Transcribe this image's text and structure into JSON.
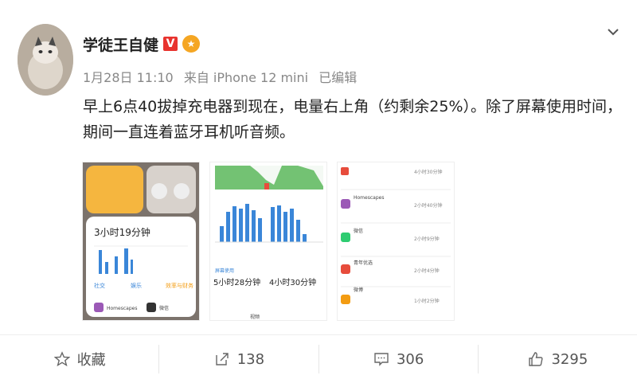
{
  "post": {
    "username": "学徒王自健",
    "verified_badge": "V",
    "meta": {
      "date": "1月28日 11:10",
      "source": "来自 iPhone 12 mini",
      "edited": "已编辑"
    },
    "content": "早上6点40拔掉充电器到现在，电量右上角（约剩余25%）。除了屏幕使用时间，期间一直连着蓝牙耳机听音频。",
    "images": [
      {
        "subtitle_text": "3小时19分钟",
        "small_labels": [
          "社交",
          "娱乐",
          "效率与财务"
        ],
        "app_labels": [
          "Homescapes",
          "微信"
        ]
      },
      {
        "left_label": "屏幕使用",
        "left_value": "5小时28分钟",
        "right_value": "4小时30分钟",
        "bottom_label": "视频"
      },
      {
        "apps": [
          {
            "name": "",
            "time": "4小时30分钟",
            "color": "#e74c3c"
          },
          {
            "name": "Homescapes",
            "time": "2小时40分钟",
            "color": "#9b59b6"
          },
          {
            "name": "微信",
            "time": "2小时9分钟",
            "color": "#2ecc71"
          },
          {
            "name": "青年优选",
            "time": "2小时4分钟",
            "color": "#e74c3c"
          },
          {
            "name": "微博",
            "time": "1小时2分钟",
            "color": "#f39c12"
          }
        ]
      }
    ]
  },
  "actions": {
    "favorite": "收藏",
    "share_count": "138",
    "comment_count": "306",
    "like_count": "3295"
  },
  "colors": {
    "badge_red": "#e8332e",
    "chart_blue": "#3a86d8",
    "chart_green": "#5cb85c"
  }
}
